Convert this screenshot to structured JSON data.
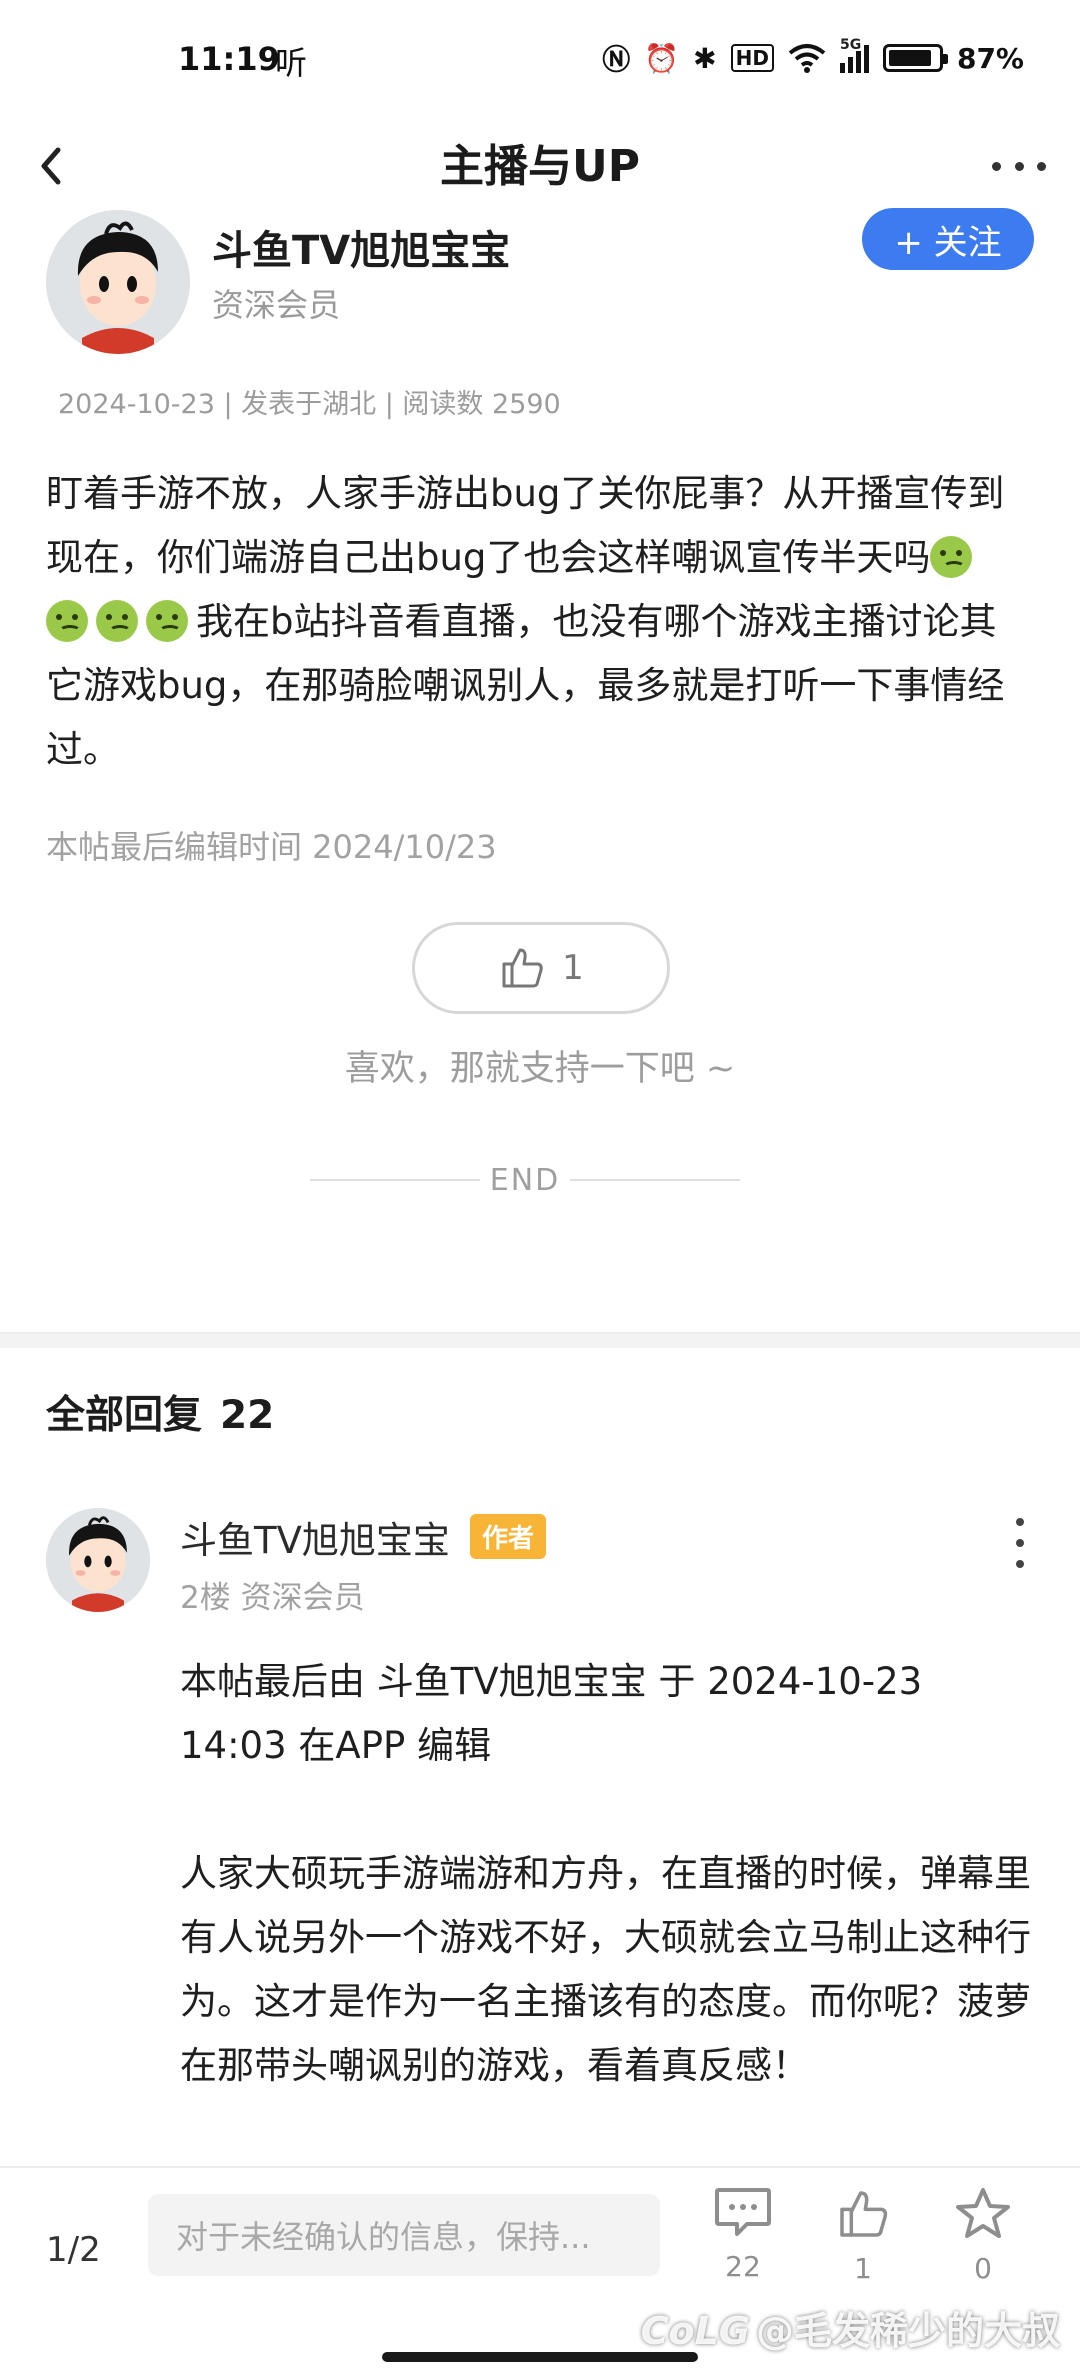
{
  "status_bar": {
    "time": "11:19",
    "listen_glyph": "听",
    "network": "5G",
    "hd": "HD",
    "battery_pct": "87%",
    "battery_level": 0.87,
    "icons": [
      "nfc-icon",
      "alarm-icon",
      "bluetooth-icon",
      "hd-icon",
      "wifi-icon",
      "signal-icon",
      "battery-icon"
    ]
  },
  "nav": {
    "title": "主播与UP"
  },
  "post": {
    "author_name": "斗鱼TV旭旭宝宝",
    "author_level": "资深会员",
    "follow_label": "+ 关注",
    "meta": "2024-10-23 | 发表于湖北 | 阅读数 2590",
    "body_before_emoji": "盯着手游不放，人家手游出bug了关你屁事？从开播宣传到现在，你们端游自己出bug了也会这样嘲讽宣传半天吗",
    "emoji_count": 4,
    "body_after_emoji": "我在b站抖音看直播，也没有哪个游戏主播讨论其它游戏bug，在那骑脸嘲讽别人，最多就是打听一下事情经过。",
    "edit_time": "本帖最后编辑时间 2024/10/23",
    "like_count": "1",
    "like_hint": "喜欢，那就支持一下吧 ~",
    "end_label": "END"
  },
  "replies": {
    "label": "全部回复",
    "count": "22",
    "items": [
      {
        "name": "斗鱼TV旭旭宝宝",
        "badge": "作者",
        "sub": "2楼 资深会员",
        "edit_note": "本帖最后由 斗鱼TV旭旭宝宝 于 2024-10-23 14:03 在APP 编辑",
        "body": "人家大硕玩手游端游和方舟，在直播的时候，弹幕里有人说另外一个游戏不好，大硕就会立马制止这种行为。这才是作为一名主播该有的态度。而你呢？菠萝在那带头嘲讽别的游戏，看着真反感！"
      }
    ]
  },
  "bottom_bar": {
    "page_indicator": "1/2",
    "input_placeholder": "对于未经确认的信息，保持...",
    "comment_count": "22",
    "like_count": "1",
    "star_count": "0"
  },
  "watermark": "@毛发稀少的大叔",
  "colors": {
    "accent": "#3d7cf0",
    "badge": "#f8b436"
  }
}
